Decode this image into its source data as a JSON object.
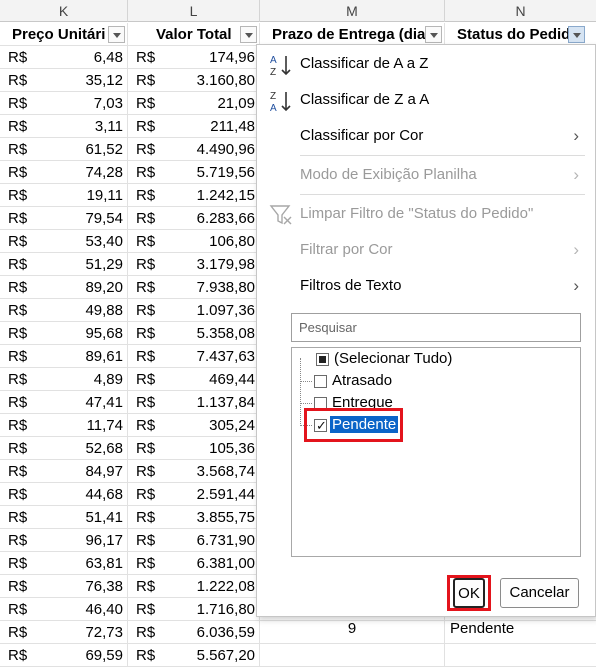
{
  "columns": [
    "K",
    "L",
    "M",
    "N"
  ],
  "headers": {
    "k": "Preço Unitári",
    "l": "Valor Total",
    "m": "Prazo de Entrega (dias",
    "n": "Status do Pedido"
  },
  "currency": "R$",
  "rows": [
    [
      "6,48",
      "174,96"
    ],
    [
      "35,12",
      "3.160,80"
    ],
    [
      "7,03",
      "21,09"
    ],
    [
      "3,11",
      "211,48"
    ],
    [
      "61,52",
      "4.490,96"
    ],
    [
      "74,28",
      "5.719,56"
    ],
    [
      "19,11",
      "1.242,15"
    ],
    [
      "79,54",
      "6.283,66"
    ],
    [
      "53,40",
      "106,80"
    ],
    [
      "51,29",
      "3.179,98"
    ],
    [
      "89,20",
      "7.938,80"
    ],
    [
      "49,88",
      "1.097,36"
    ],
    [
      "95,68",
      "5.358,08"
    ],
    [
      "89,61",
      "7.437,63"
    ],
    [
      "4,89",
      "469,44"
    ],
    [
      "47,41",
      "1.137,84"
    ],
    [
      "11,74",
      "305,24"
    ],
    [
      "52,68",
      "105,36"
    ],
    [
      "84,97",
      "3.568,74"
    ],
    [
      "44,68",
      "2.591,44"
    ],
    [
      "51,41",
      "3.855,75"
    ],
    [
      "96,17",
      "6.731,90"
    ],
    [
      "63,81",
      "6.381,00"
    ],
    [
      "76,38",
      "1.222,08"
    ],
    [
      "46,40",
      "1.716,80"
    ],
    [
      "72,73",
      "6.036,59"
    ],
    [
      "69,59",
      "5.567,20"
    ]
  ],
  "last_row": {
    "prazo": "9",
    "status": "Pendente"
  },
  "menu": {
    "sort_az": "Classificar de A a Z",
    "sort_za": "Classificar de Z a A",
    "sort_color": "Classificar por Cor",
    "sheet_view": "Modo de Exibição Planilha",
    "clear_filter": "Limpar Filtro de \"Status do Pedido\"",
    "filter_color": "Filtrar por Cor",
    "text_filters": "Filtros de Texto",
    "search_placeholder": "Pesquisar",
    "items": [
      "(Selecionar Tudo)",
      "Atrasado",
      "Entregue",
      "Pendente"
    ],
    "ok": "OK",
    "cancel": "Cancelar"
  },
  "colors": {
    "highlight": "#e3141c",
    "selection": "#0a64c8",
    "annotation_arrow": "#e3141c"
  }
}
